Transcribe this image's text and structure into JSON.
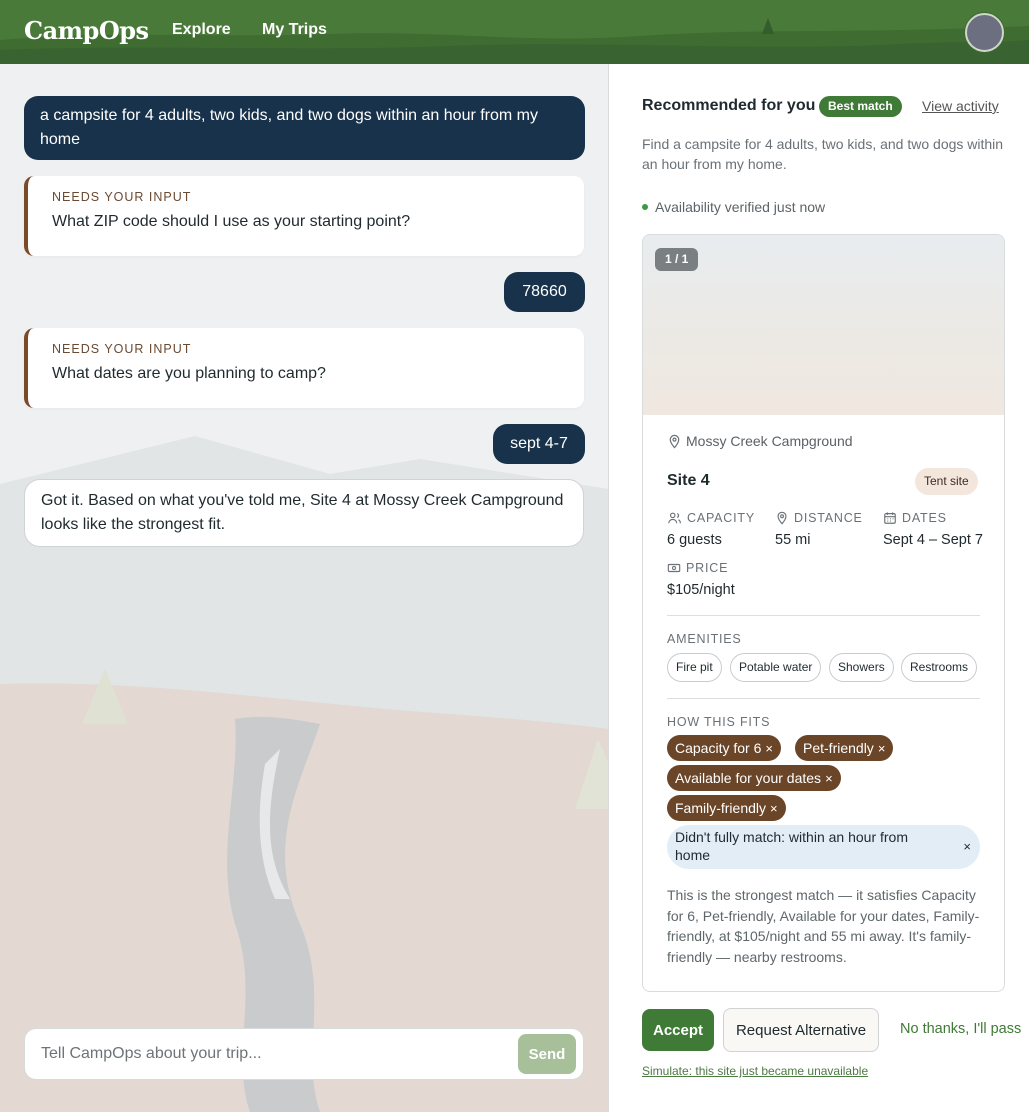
{
  "header": {
    "logo": "CampOps",
    "nav": {
      "explore": "Explore",
      "my_trips": "My Trips"
    }
  },
  "chat": {
    "messages": {
      "user1": "a campsite for 4 adults, two kids, and two dogs within an hour from my home",
      "bot_q1_kicker": "NEEDS YOUR INPUT",
      "bot_q1": "What ZIP code should I use as your starting point?",
      "user2": "78660",
      "bot_q2_kicker": "NEEDS YOUR INPUT",
      "bot_q2": "What dates are you planning to camp?",
      "user3": "sept 4-7",
      "bot_final": "Got it. Based on what you've told me, Site 4 at Mossy Creek Campground looks like the strongest fit."
    },
    "input": {
      "placeholder": "Tell CampOps about your trip...",
      "send_label": "Send"
    }
  },
  "recommendation": {
    "title": "Recommended for you",
    "badge": "Best match",
    "view_activity": "View activity",
    "description": "Find a campsite for 4 adults, two kids, and two dogs within an hour from my home.",
    "availability": "Availability verified just now",
    "image_counter": "1 / 1",
    "campground": "Mossy Creek Campground",
    "site_name": "Site 4",
    "site_type": "Tent site",
    "stats": {
      "capacity_label": "CAPACITY",
      "capacity_value": "6 guests",
      "distance_label": "DISTANCE",
      "distance_value": "55 mi",
      "dates_label": "DATES",
      "dates_value": "Sept 4 – Sept 7",
      "price_label": "PRICE",
      "price_value": "$105/night"
    },
    "amenities_label": "AMENITIES",
    "amenities": [
      "Fire pit",
      "Potable water",
      "Showers",
      "Restrooms"
    ],
    "fits_label": "HOW THIS FITS",
    "fits": [
      "Capacity for 6",
      "Pet-friendly",
      "Available for your dates",
      "Family-friendly"
    ],
    "miss": "Didn't fully match: within an hour from home",
    "remove_glyph": "×",
    "explanation": "This is the strongest match — it satisfies Capacity for 6, Pet-friendly, Available for your dates, Family-friendly, at $105/night and 55 mi away. It's family-friendly — nearby restrooms.",
    "actions": {
      "accept": "Accept",
      "request_alternative": "Request Alternative",
      "decline": "No thanks, I'll pass",
      "simulate": "Simulate: this site just became unavailable"
    }
  },
  "colors": {
    "header_green": "#4a7a3a",
    "user_bubble": "#17324a",
    "accent_brown": "#6b4527",
    "accept_green": "#3f7a36"
  }
}
